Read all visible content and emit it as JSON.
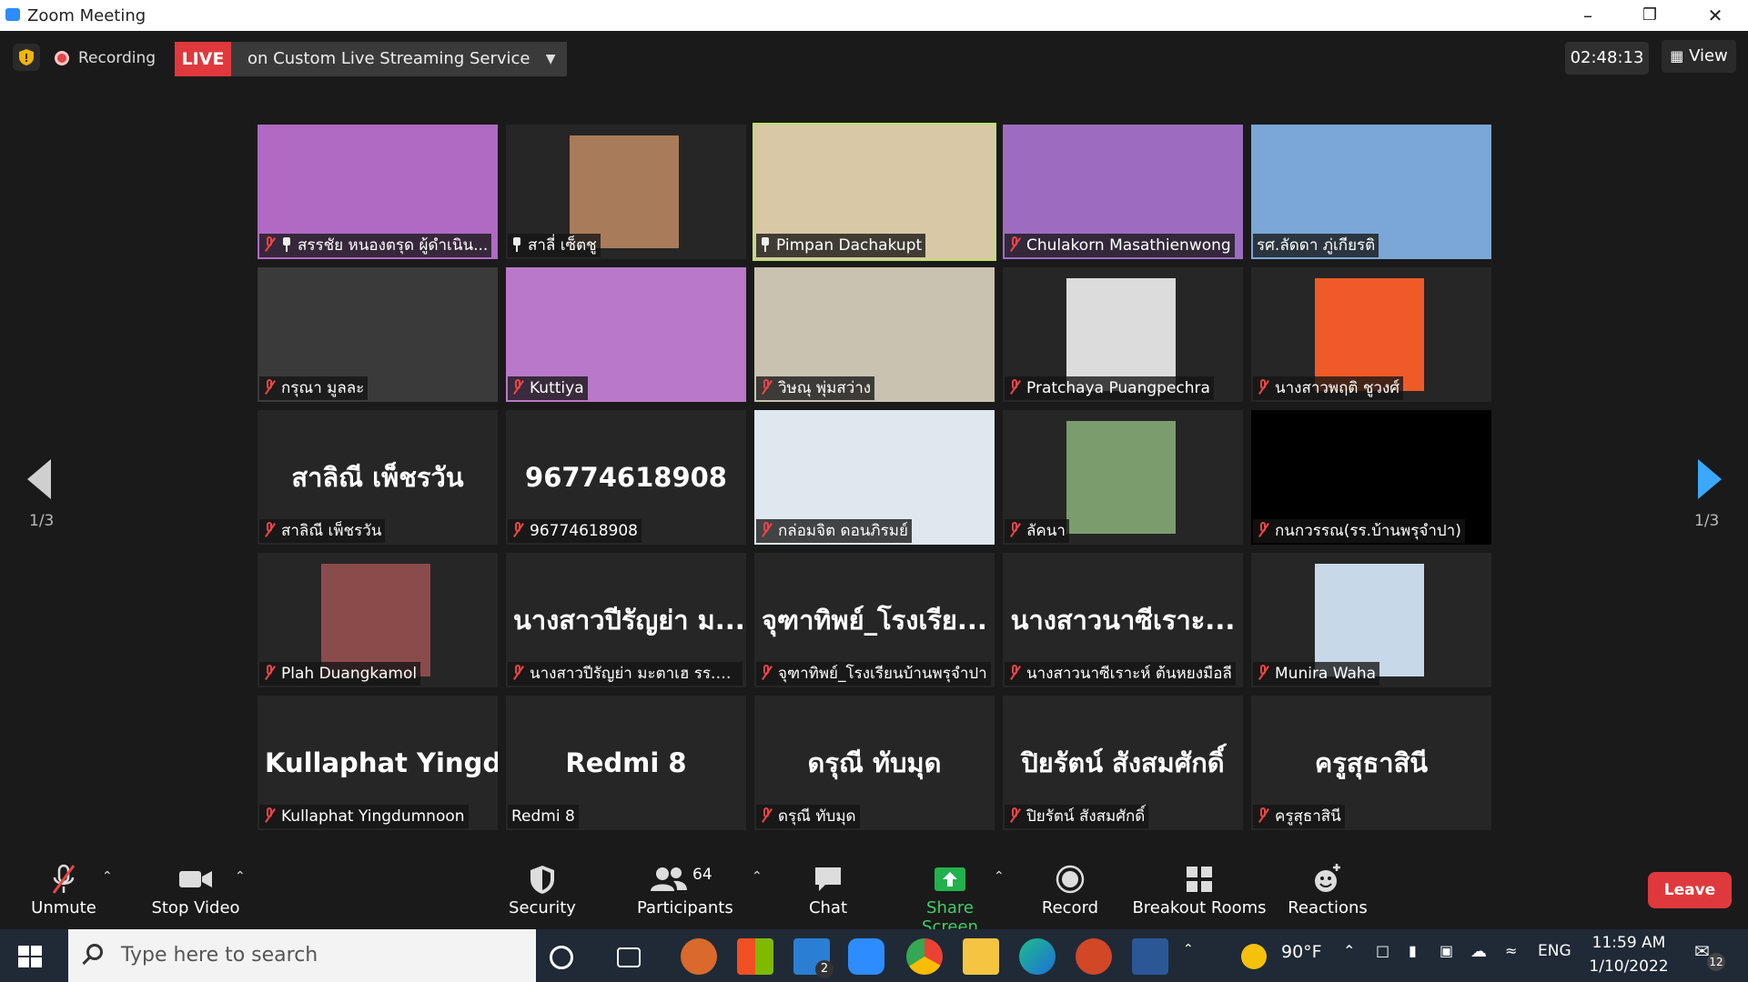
{
  "window": {
    "title": "Zoom Meeting",
    "controls": [
      "minimize-icon",
      "restore-icon",
      "close-icon"
    ]
  },
  "topbar": {
    "recording_label": "Recording",
    "live_label": "LIVE",
    "live_service": "on Custom Live Streaming Service",
    "timer": "02:48:13",
    "view_label": "View"
  },
  "pagination": {
    "left": "1/3",
    "right": "1/3"
  },
  "participants": [
    {
      "label": "สรรชัย หนองตรุด ผู้ดำเนิน...",
      "video": true,
      "muted": true,
      "pinned": true
    },
    {
      "label": "สาลี่ เซ็ตชู",
      "video": true,
      "muted": false,
      "pinned": true
    },
    {
      "label": "Pimpan Dachakupt",
      "video": true,
      "muted": false,
      "pinned": true,
      "active": true
    },
    {
      "label": "Chulakorn Masathienwong",
      "video": true,
      "muted": true
    },
    {
      "label": "รศ.ลัดดา ภู่เกียรติ",
      "video": true,
      "muted": false
    },
    {
      "label": "กรุณา มูลละ",
      "video": true,
      "muted": true
    },
    {
      "label": "Kuttiya",
      "video": true,
      "muted": true
    },
    {
      "label": "วิษณุ พุ่มสว่าง",
      "video": true,
      "muted": true
    },
    {
      "label": "Pratchaya Puangpechra",
      "video": true,
      "muted": true
    },
    {
      "label": "นางสาวพฤติ ชูวงศ์",
      "video": true,
      "muted": true
    },
    {
      "big": "สาลิณี เพ็ชรวัน",
      "label": "สาลิณี เพ็ชรวัน",
      "video": false,
      "muted": true
    },
    {
      "big": "96774618908",
      "label": "96774618908",
      "video": false,
      "muted": true
    },
    {
      "label": "กล่อมจิต ดอนภิรมย์",
      "video": true,
      "muted": true
    },
    {
      "label": "ลัคนา",
      "video": true,
      "muted": true
    },
    {
      "label": "กนกวรรณ(รร.บ้านพรุจำปา)",
      "video": true,
      "muted": true
    },
    {
      "label": "Plah Duangkamol",
      "video": true,
      "muted": true
    },
    {
      "big": "นางสาวปีรัญย่า ม...",
      "label": "นางสาวปีรัญย่า มะตาเฮ รร.บ้า...",
      "video": false,
      "muted": true
    },
    {
      "big": "จุฑาทิพย์_โรงเรีย...",
      "label": "จุฑาทิพย์_โรงเรียนบ้านพรุจำปา",
      "video": false,
      "muted": true
    },
    {
      "big": "นางสาวนาซีเราะ...",
      "label": "นางสาวนาซีเราะห์ ต้นหยงมือลี",
      "video": false,
      "muted": true
    },
    {
      "label": "Munira Waha",
      "video": true,
      "muted": true
    },
    {
      "big": "Kullaphat Yingd...",
      "label": "Kullaphat Yingdumnoon",
      "video": false,
      "muted": true
    },
    {
      "big": "Redmi 8",
      "label": "Redmi 8",
      "video": false,
      "muted": false
    },
    {
      "big": "ดรุณี ทับมุด",
      "label": "ดรุณี ทับมุด",
      "video": false,
      "muted": true
    },
    {
      "big": "ปิยรัตน์ สังสมศักดิ์",
      "label": "ปิยรัตน์ สังสมศักดิ์",
      "video": false,
      "muted": true
    },
    {
      "big": "ครูสุธาสินี",
      "label": "ครูสุธาสินี",
      "video": false,
      "muted": true
    }
  ],
  "toolbar": {
    "unmute": "Unmute",
    "stop_video": "Stop Video",
    "security": "Security",
    "participants": "Participants",
    "participants_count": "64",
    "chat": "Chat",
    "share_screen": "Share Screen",
    "record": "Record",
    "breakout": "Breakout Rooms",
    "reactions": "Reactions",
    "leave": "Leave"
  },
  "taskbar": {
    "search_placeholder": "Type here to search",
    "mail_badge": "2",
    "weather": "90°F",
    "lang": "ENG",
    "time": "11:59 AM",
    "date": "1/10/2022",
    "notifications": "12"
  },
  "colors": {
    "live": "#e0393d",
    "accent": "#2d8cff",
    "share": "#22b14c",
    "active_speaker": "#b9e36b",
    "muted": "#e44444"
  }
}
